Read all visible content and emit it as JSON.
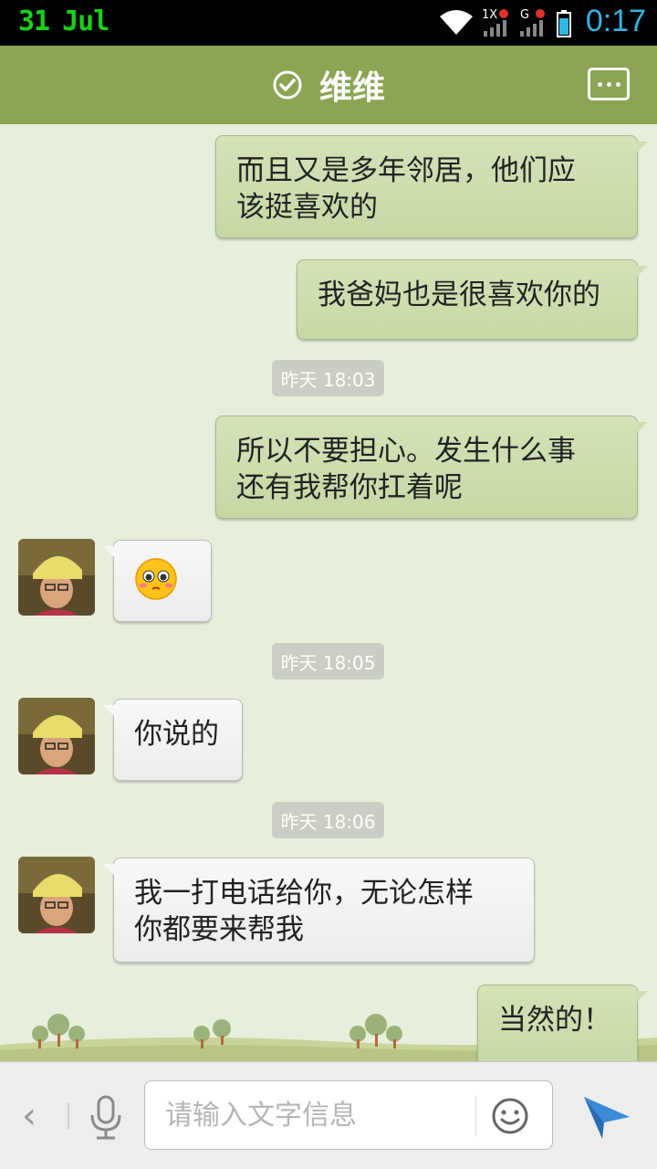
{
  "status_bar": {
    "day": "31",
    "month": "Jul",
    "time": "0:17",
    "icons": [
      "wifi-icon",
      "signal-1x-icon",
      "signal-g-icon",
      "battery-icon"
    ],
    "accent": "#33b5e5",
    "date_color": "#19d119"
  },
  "header": {
    "title": "维维",
    "icons": [
      "check-circle-icon",
      "more-menu-icon"
    ],
    "background": "#8ba553"
  },
  "messages": [
    {
      "side": "right",
      "text_lines": [
        "而且又是多年邻居，他们应",
        "该挺喜欢的"
      ]
    },
    {
      "side": "right",
      "text_lines": [
        "我爸妈也是很喜欢你的"
      ]
    },
    {
      "type": "timestamp",
      "text": "昨天 18:03"
    },
    {
      "side": "right",
      "text_lines": [
        "所以不要担心。发生什么事",
        "还有我帮你扛着呢"
      ]
    },
    {
      "side": "left",
      "emoji": "pleading-face-emoji"
    },
    {
      "type": "timestamp",
      "text": "昨天 18:05"
    },
    {
      "side": "left",
      "text_lines": [
        "你说的"
      ]
    },
    {
      "type": "timestamp",
      "text": "昨天 18:06"
    },
    {
      "side": "left",
      "text_lines": [
        "我一打电话给你，无论怎样",
        "你都要来帮我"
      ]
    },
    {
      "side": "right",
      "text_lines": [
        "当然的！"
      ]
    }
  ],
  "input_bar": {
    "placeholder": "请输入文字信息",
    "icons": [
      "back-chevron-icon",
      "microphone-icon",
      "smiley-icon",
      "send-icon"
    ]
  }
}
